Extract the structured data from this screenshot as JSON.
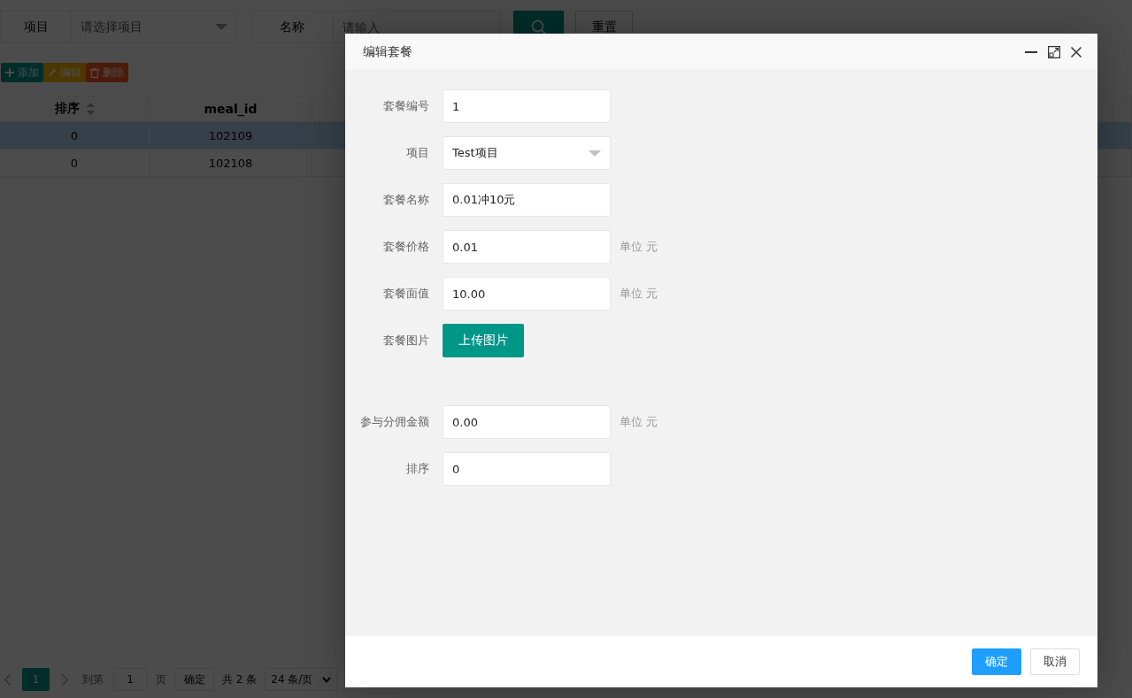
{
  "filter_bar": {
    "fields": [
      {
        "label": "项目",
        "kind": "select",
        "placeholder": "请选择项目"
      },
      {
        "label": "名称",
        "kind": "input",
        "placeholder": "请输入"
      }
    ],
    "reset_button": "重置"
  },
  "toolbar": {
    "buttons": [
      {
        "label": "添加",
        "kind": "add"
      },
      {
        "label": "编辑",
        "kind": "edit"
      },
      {
        "label": "删除",
        "kind": "delete"
      }
    ]
  },
  "table": {
    "columns": [
      {
        "label": "排序",
        "sortable": true
      },
      {
        "label": "meal_id",
        "sortable": false
      }
    ],
    "rows": [
      {
        "cells": [
          "0",
          "102109"
        ],
        "selected": true
      },
      {
        "cells": [
          "0",
          "102108"
        ],
        "selected": false
      }
    ]
  },
  "pagination": {
    "pages": [
      {
        "label": "1",
        "selected": true
      }
    ],
    "goto_label": "到第",
    "goto_value": "1",
    "page_unit": "页",
    "confirm_button": "确定",
    "total": "共 2 条",
    "page_size": "24 条/页"
  },
  "dialog": {
    "title": "编辑套餐",
    "fields": [
      {
        "label": "套餐编号",
        "kind": "input",
        "value": "1"
      },
      {
        "label": "项目",
        "kind": "select",
        "value": "Test项目"
      },
      {
        "label": "套餐名称",
        "kind": "input",
        "value": "0.01冲10元"
      },
      {
        "label": "套餐价格",
        "kind": "input",
        "value": "0.01",
        "unit": "单位 元"
      },
      {
        "label": "套餐面值",
        "kind": "input",
        "value": "10.00",
        "unit": "单位 元"
      },
      {
        "label": "套餐图片",
        "kind": "upload",
        "button": "上传图片"
      },
      {
        "label": "参与分佣金额",
        "kind": "input",
        "value": "0.00",
        "unit": "单位 元"
      },
      {
        "label": "排序",
        "kind": "input",
        "value": "0"
      }
    ],
    "buttons": [
      {
        "label": "确定",
        "kind": "primary"
      },
      {
        "label": "取消",
        "kind": "default"
      }
    ]
  }
}
